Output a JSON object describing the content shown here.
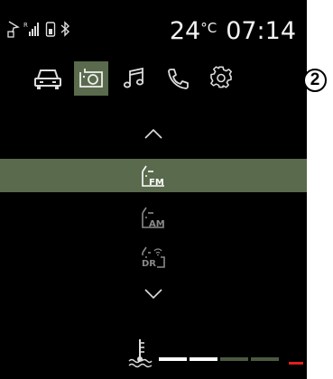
{
  "status_bar": {
    "icons": [
      "navigation-arrow-icon",
      "signal-strength-icon",
      "phone-battery-icon",
      "bluetooth-icon"
    ],
    "temperature_value": "24",
    "temperature_unit": "°C",
    "time": "07:14"
  },
  "nav": {
    "items": [
      {
        "name": "vehicle",
        "icon": "car-icon",
        "active": false
      },
      {
        "name": "media",
        "icon": "radio-icon",
        "active": true
      },
      {
        "name": "music",
        "icon": "music-note-icon",
        "active": false
      },
      {
        "name": "phone",
        "icon": "phone-icon",
        "active": false
      },
      {
        "name": "settings",
        "icon": "gear-icon",
        "active": false
      }
    ]
  },
  "sources": [
    {
      "label": "FM",
      "selected": true
    },
    {
      "label": "AM",
      "selected": false
    },
    {
      "label": "DR",
      "selected": false
    }
  ],
  "controls": {
    "up": "chevron-up-icon",
    "down": "chevron-down-icon"
  },
  "coolant_gauge": {
    "icon": "coolant-temperature-icon",
    "filled_segments": 2,
    "total_segments": 4,
    "segment_colors": [
      "#ffffff",
      "#ffffff",
      "#4a5a40",
      "#4a5a40"
    ],
    "warning_color": "#e02020"
  },
  "callout": {
    "number": "2"
  }
}
